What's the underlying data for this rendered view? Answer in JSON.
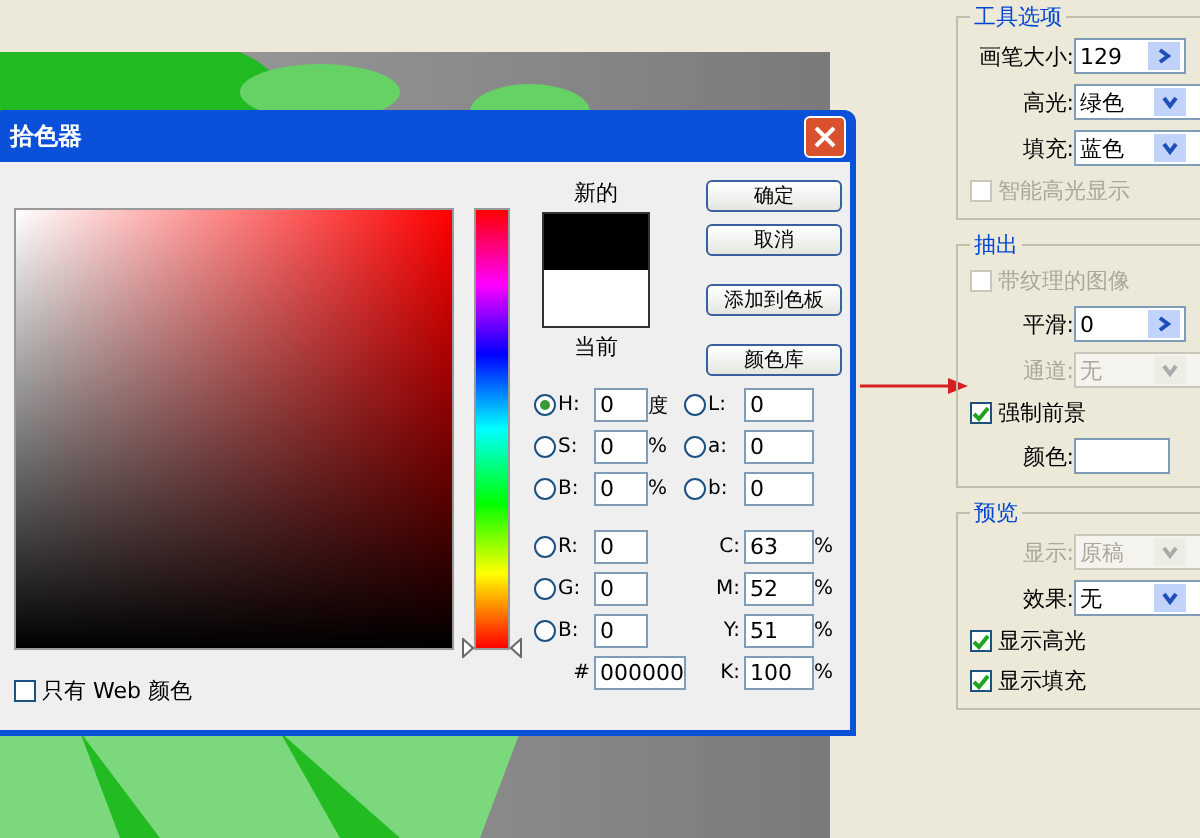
{
  "dialog": {
    "title": "拾色器",
    "new_label": "新的",
    "current_label": "当前",
    "hue_slider": {
      "level": 0
    },
    "buttons": [
      "确定",
      "取消",
      "添加到色板",
      "颜色库"
    ],
    "web_only": {
      "label": "只有 Web 颜色",
      "checked": false
    },
    "hsb_rgb": [
      {
        "label": "H:",
        "value": "0",
        "unit": "度",
        "selected": true
      },
      {
        "label": "S:",
        "value": "0",
        "unit": "%",
        "selected": false
      },
      {
        "label": "B:",
        "value": "0",
        "unit": "%",
        "selected": false
      },
      {
        "label": "R:",
        "value": "0",
        "selected": false
      },
      {
        "label": "G:",
        "value": "0",
        "selected": false
      },
      {
        "label": "B:",
        "value": "0",
        "selected": false
      }
    ],
    "lab": [
      {
        "label": "L:",
        "value": "0",
        "selected": false
      },
      {
        "label": "a:",
        "value": "0",
        "selected": false
      },
      {
        "label": "b:",
        "value": "0",
        "selected": false
      }
    ],
    "cmyk": [
      {
        "label": "C:",
        "value": "63",
        "unit": "%"
      },
      {
        "label": "M:",
        "value": "52",
        "unit": "%"
      },
      {
        "label": "Y:",
        "value": "51",
        "unit": "%"
      },
      {
        "label": "K:",
        "value": "100",
        "unit": "%"
      }
    ],
    "hex": {
      "label": "#",
      "value": "000000"
    }
  },
  "panel": {
    "groups": [
      {
        "title": "工具选项",
        "items": [
          {
            "kind": "spinner",
            "label": "画笔大小:",
            "value": "129",
            "disabled": false
          },
          {
            "kind": "dropdown",
            "label": "高光:",
            "value": "绿色",
            "disabled": false
          },
          {
            "kind": "dropdown",
            "label": "填充:",
            "value": "蓝色",
            "disabled": false
          },
          {
            "kind": "checkbox",
            "label": "智能高光显示",
            "checked": false,
            "disabled": true
          }
        ]
      },
      {
        "title": "抽出",
        "items": [
          {
            "kind": "checkbox",
            "label": "带纹理的图像",
            "checked": false,
            "disabled": true
          },
          {
            "kind": "spinner",
            "label": "平滑:",
            "value": "0",
            "disabled": false
          },
          {
            "kind": "dropdown",
            "label": "通道:",
            "value": "无",
            "disabled": true
          },
          {
            "kind": "checkbox",
            "label": "强制前景",
            "checked": true,
            "disabled": false
          },
          {
            "kind": "color",
            "label": "颜色:",
            "color": "#ffffff",
            "disabled": false
          }
        ]
      },
      {
        "title": "预览",
        "items": [
          {
            "kind": "dropdown",
            "label": "显示:",
            "value": "原稿",
            "disabled": true
          },
          {
            "kind": "dropdown",
            "label": "效果:",
            "value": "无",
            "disabled": false
          },
          {
            "kind": "checkbox",
            "label": "显示高光",
            "checked": true,
            "disabled": false
          },
          {
            "kind": "checkbox",
            "label": "显示填充",
            "checked": true,
            "disabled": false
          }
        ]
      }
    ]
  }
}
